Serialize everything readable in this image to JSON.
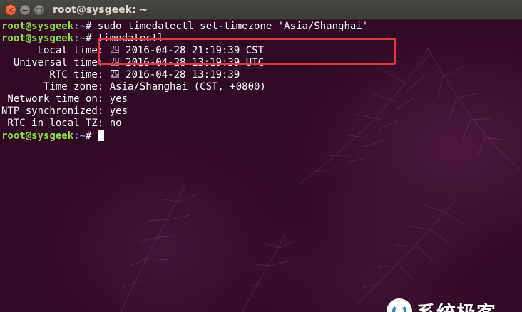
{
  "window": {
    "title": "root@sysgeek: ~",
    "buttons": {
      "close": "✕",
      "minimize": "−",
      "maximize": "□"
    }
  },
  "terminal": {
    "prompt_user": "root@sysgeek",
    "prompt_path": ":~",
    "prompt_symbol": "# ",
    "commands": [
      "sudo timedatectl set-timezone 'Asia/Shanghai'",
      "timedatectl"
    ],
    "output": [
      "      Local time: 四 2016-04-28 21:19:39 CST",
      "  Universal time: 四 2016-04-28 13:19:39 UTC",
      "        RTC time: 四 2016-04-28 13:19:39",
      "       Time zone: Asia/Shanghai (CST, +0800)",
      " Network time on: yes",
      "NTP synchronized: yes",
      " RTC in local TZ: no"
    ]
  },
  "watermark": {
    "text": "系统极客"
  },
  "colors": {
    "terminal_bg": "#300a24",
    "prompt_user": "#8ae234",
    "prompt_path": "#729fcf",
    "highlight_box": "#e0393e",
    "titlebar": "#3c3b37"
  },
  "icons": [
    "close-icon",
    "minimize-icon",
    "maximize-icon",
    "watermark-logo-icon"
  ]
}
